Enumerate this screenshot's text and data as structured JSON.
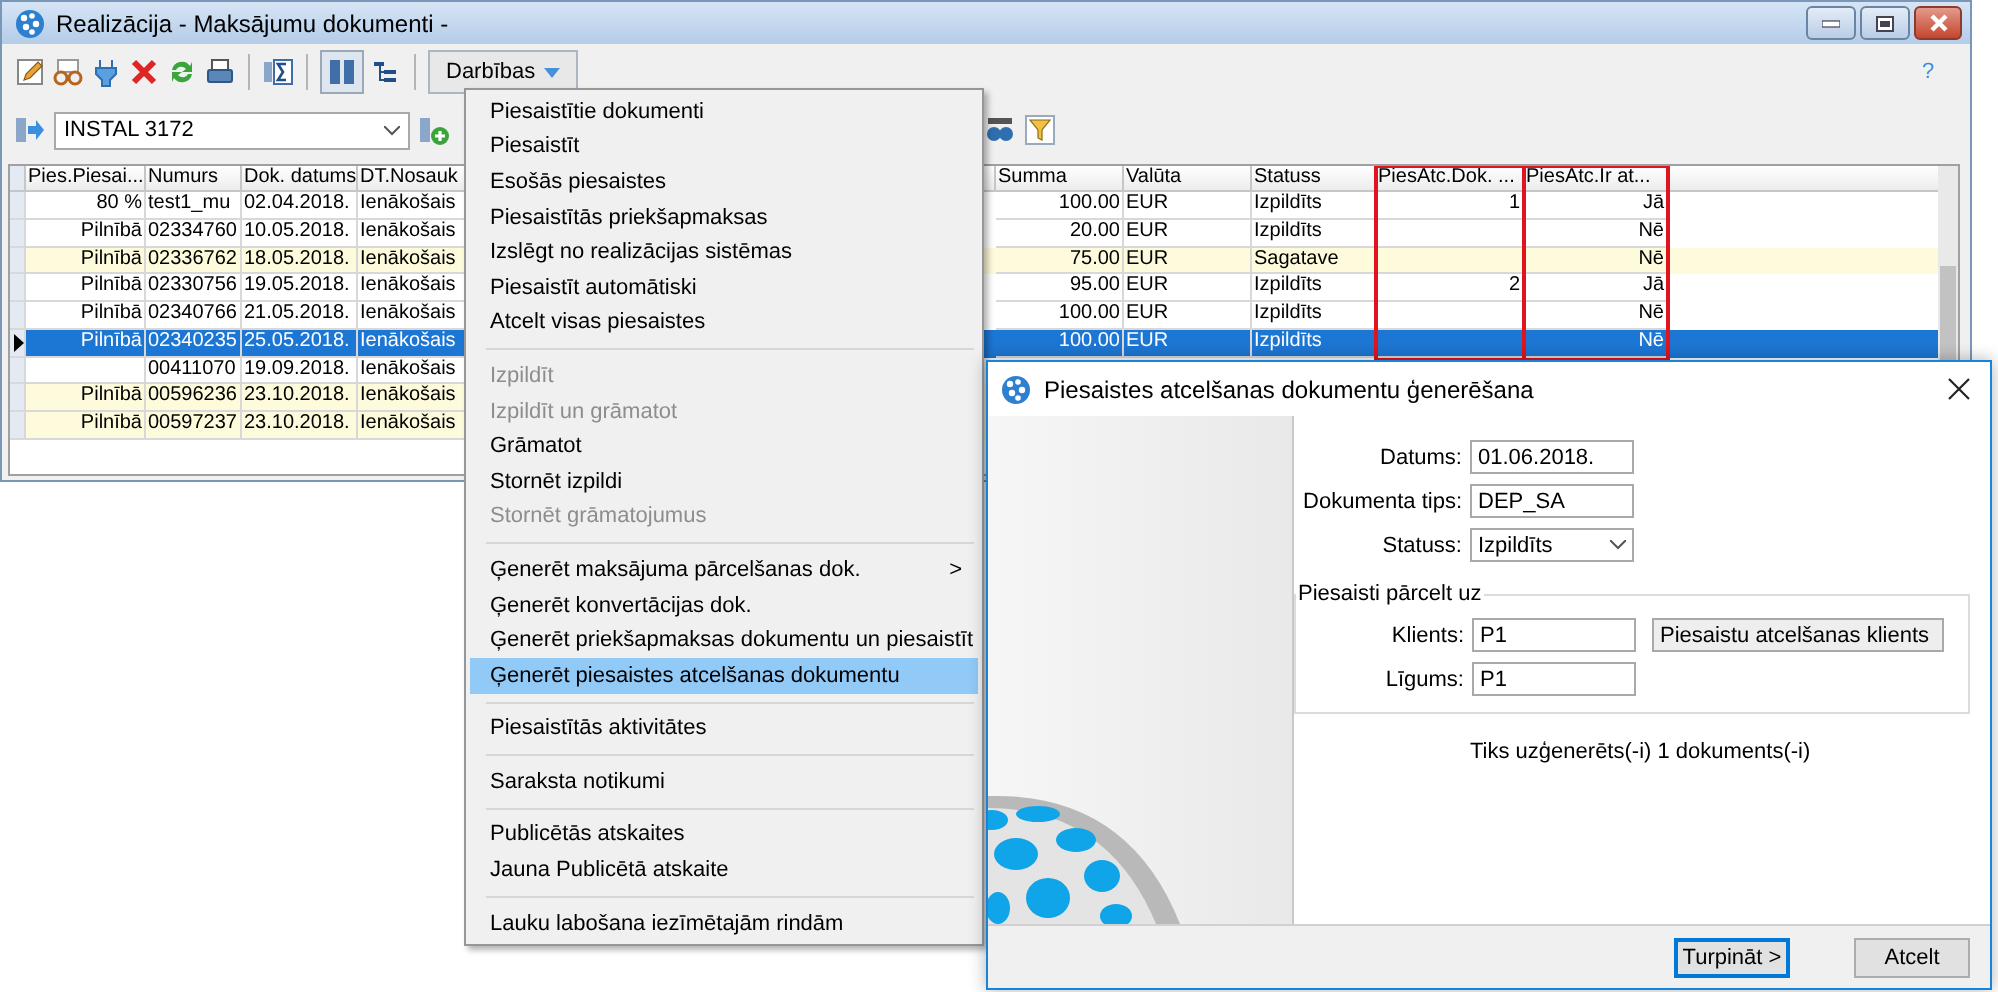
{
  "window": {
    "title": "Realizācija - Maksājumu dokumenti -",
    "toolbar": {
      "grid_button_pressed": true,
      "actions_button": "Darbības",
      "help": "?"
    },
    "filter": {
      "value": "INSTAL 3172"
    }
  },
  "table": {
    "columns": [
      {
        "label": "Pies.Piesai...",
        "framed": false
      },
      {
        "label": "Numurs",
        "framed": false
      },
      {
        "label": "Dok. datums",
        "framed": false
      },
      {
        "label": "DT.Nosauk",
        "framed": false
      },
      {
        "label": "Summa",
        "framed": false
      },
      {
        "label": "Valūta",
        "framed": false
      },
      {
        "label": "Statuss",
        "framed": false
      },
      {
        "label": "PiesAtc.Dok. ...",
        "framed": true
      },
      {
        "label": "PiesAtc.Ir at...",
        "framed": true
      }
    ],
    "rows": [
      {
        "selected": false,
        "highlighted": false,
        "cells": [
          "80 %",
          "test1_mu",
          "02.04.2018.",
          "Ienākošais",
          "100.00",
          "EUR",
          "Izpildīts",
          "1",
          "Jā"
        ]
      },
      {
        "selected": false,
        "highlighted": false,
        "cells": [
          "Pilnībā",
          "02334760",
          "10.05.2018.",
          "Ienākošais",
          "20.00",
          "EUR",
          "Izpildīts",
          "",
          "Nē"
        ]
      },
      {
        "selected": false,
        "highlighted": true,
        "cells": [
          "Pilnībā",
          "02336762",
          "18.05.2018.",
          "Ienākošais",
          "75.00",
          "EUR",
          "Sagatave",
          "",
          "Nē"
        ]
      },
      {
        "selected": false,
        "highlighted": false,
        "cells": [
          "Pilnībā",
          "02330756",
          "19.05.2018.",
          "Ienākošais",
          "95.00",
          "EUR",
          "Izpildīts",
          "2",
          "Jā"
        ]
      },
      {
        "selected": false,
        "highlighted": false,
        "cells": [
          "Pilnībā",
          "02340766",
          "21.05.2018.",
          "Ienākošais",
          "100.00",
          "EUR",
          "Izpildīts",
          "",
          "Nē"
        ]
      },
      {
        "selected": true,
        "highlighted": false,
        "cells": [
          "Pilnībā",
          "02340235",
          "25.05.2018.",
          "Ienākošais",
          "100.00",
          "EUR",
          "Izpildīts",
          "",
          "Nē"
        ]
      },
      {
        "selected": false,
        "highlighted": false,
        "cells": [
          "",
          "00411070",
          "19.09.2018.",
          "Ienākošais"
        ]
      },
      {
        "selected": false,
        "highlighted": true,
        "cells": [
          "Pilnībā",
          "00596236",
          "23.10.2018.",
          "Ienākošais"
        ]
      },
      {
        "selected": false,
        "highlighted": true,
        "cells": [
          "Pilnībā",
          "00597237",
          "23.10.2018.",
          "Ienākošais"
        ]
      }
    ]
  },
  "menu": {
    "sections": [
      [
        {
          "label": "Piesaistītie dokumenti",
          "disabled": false,
          "selected": false
        },
        {
          "label": "Piesaistīt",
          "disabled": false,
          "selected": false
        },
        {
          "label": "Esošās piesaistes",
          "disabled": false,
          "selected": false
        },
        {
          "label": "Piesaistītās priekšapmaksas",
          "disabled": false,
          "selected": false
        },
        {
          "label": "Izslēgt no realizācijas sistēmas",
          "disabled": false,
          "selected": false
        },
        {
          "label": "Piesaistīt automātiski",
          "disabled": false,
          "selected": false
        },
        {
          "label": "Atcelt visas piesaistes",
          "disabled": false,
          "selected": false
        }
      ],
      [
        {
          "label": "Izpildīt",
          "disabled": true,
          "selected": false
        },
        {
          "label": "Izpildīt un grāmatot",
          "disabled": true,
          "selected": false
        },
        {
          "label": "Grāmatot",
          "disabled": false,
          "selected": false
        },
        {
          "label": "Stornēt izpildi",
          "disabled": false,
          "selected": false
        },
        {
          "label": "Stornēt grāmatojumus",
          "disabled": true,
          "selected": false
        }
      ],
      [
        {
          "label": "Ģenerēt maksājuma pārcelšanas dok.",
          "disabled": false,
          "selected": false,
          "arrow": ">"
        },
        {
          "label": "Ģenerēt konvertācijas dok.",
          "disabled": false,
          "selected": false
        },
        {
          "label": "Ģenerēt priekšapmaksas dokumentu un piesaistīt",
          "disabled": false,
          "selected": false
        },
        {
          "label": "Ģenerēt piesaistes atcelšanas dokumentu",
          "disabled": false,
          "selected": true
        }
      ],
      [
        {
          "label": "Piesaistītās aktivitātes",
          "disabled": false,
          "selected": false
        }
      ],
      [
        {
          "label": "Saraksta notikumi",
          "disabled": false,
          "selected": false
        }
      ],
      [
        {
          "label": "Publicētās atskaites",
          "disabled": false,
          "selected": false
        },
        {
          "label": "Jauna Publicētā atskaite",
          "disabled": false,
          "selected": false
        }
      ],
      [
        {
          "label": "Lauku labošana iezīmētajām rindām",
          "disabled": false,
          "selected": false
        }
      ]
    ]
  },
  "dialog": {
    "title": "Piesaistes atcelšanas dokumentu ģenerēšana",
    "fields": [
      {
        "kind": "text",
        "label": "Datums:",
        "value": "01.06.2018."
      },
      {
        "kind": "text",
        "label": "Dokumenta tips:",
        "value": "DEP_SA"
      },
      {
        "kind": "dropdown",
        "label": "Statuss:",
        "value": "Izpildīts"
      }
    ],
    "group": {
      "title": "Piesaisti pārcelt uz",
      "fields": [
        {
          "kind": "text",
          "label": "Klients:",
          "value": "P1",
          "note": "Piesaistu atcelšanas klients"
        },
        {
          "kind": "text",
          "label": "Līgums:",
          "value": "P1"
        }
      ]
    },
    "summary": "Tiks uzģenerēts(-i) 1 dokuments(-i)",
    "buttons": [
      {
        "label": "Turpināt >",
        "default": true
      },
      {
        "label": "Atcelt",
        "default": false
      }
    ]
  }
}
